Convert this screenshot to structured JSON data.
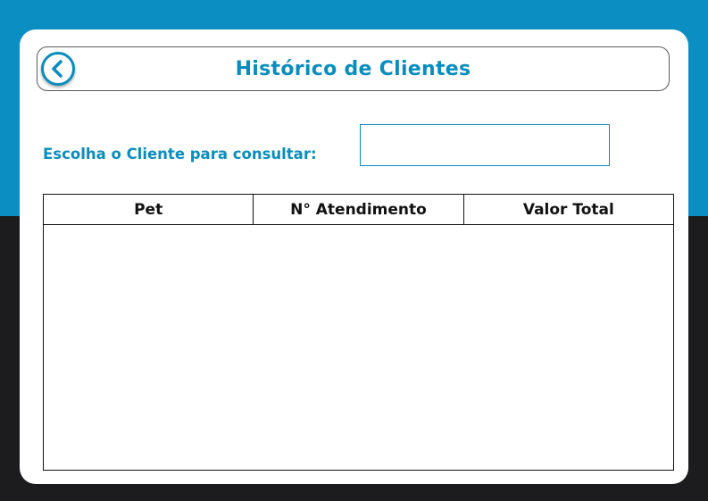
{
  "colors": {
    "accent": "#0a8dbd",
    "top_band": "#0b8fc2",
    "bottom_band": "#1c1c1e",
    "card": "#ffffff"
  },
  "header": {
    "back_icon": "chevron-left-icon",
    "title": "Histórico de Clientes"
  },
  "client_selector": {
    "label": "Escolha o Cliente para consultar:",
    "value": "",
    "placeholder": ""
  },
  "table": {
    "columns": [
      "Pet",
      "N° Atendimento",
      "Valor Total"
    ],
    "rows": []
  }
}
